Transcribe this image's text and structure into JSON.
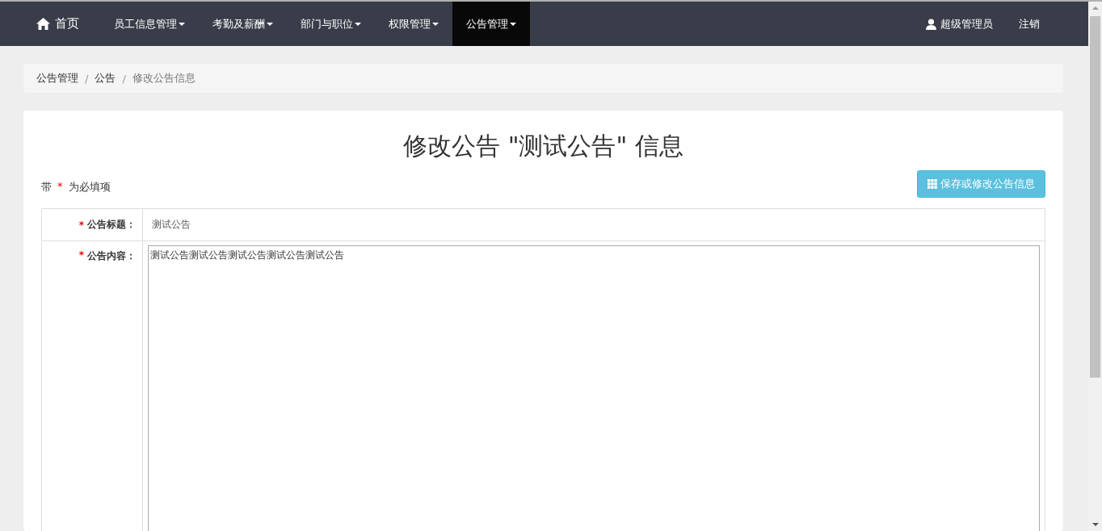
{
  "navbar": {
    "home": {
      "label": "首页"
    },
    "menus": [
      {
        "label": "员工信息管理",
        "selected": false
      },
      {
        "label": "考勤及薪酬",
        "selected": false
      },
      {
        "label": "部门与职位",
        "selected": false
      },
      {
        "label": "权限管理",
        "selected": false
      },
      {
        "label": "公告管理",
        "selected": true
      }
    ],
    "user": "超级管理员",
    "logout": "注销"
  },
  "breadcrumb_separator": "/",
  "breadcrumb": [
    {
      "label": "公告管理",
      "current": false
    },
    {
      "label": "公告",
      "current": false
    },
    {
      "label": "修改公告信息",
      "current": true
    }
  ],
  "page_title": "修改公告 \"测试公告\" 信息",
  "required_note": {
    "prefix": "带",
    "marker": "*",
    "suffix": "为必填项"
  },
  "save_button": "保存或修改公告信息",
  "fields": [
    {
      "kind": "input",
      "label": "公告标题：",
      "required": true,
      "value": "测试公告"
    },
    {
      "kind": "textarea",
      "label": "公告内容：",
      "required": true,
      "value": "测试公告测试公告测试公告测试公告测试公告"
    }
  ]
}
